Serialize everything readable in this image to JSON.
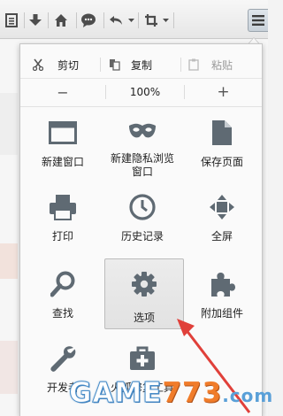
{
  "toolbar": {
    "buttons": [
      {
        "name": "bookmark-list-icon"
      },
      {
        "name": "download-icon"
      },
      {
        "name": "home-icon"
      },
      {
        "name": "chat-icon"
      },
      {
        "name": "undo-icon"
      },
      {
        "name": "crop-icon"
      },
      {
        "name": "hamburger-menu-icon"
      }
    ]
  },
  "menu": {
    "edit": {
      "cut_label": "剪切",
      "copy_label": "复制",
      "paste_label": "粘贴"
    },
    "zoom": {
      "minus_label": "−",
      "value": "100%",
      "plus_label": "+"
    },
    "items": [
      {
        "label": "新建窗口",
        "icon": "window-icon"
      },
      {
        "label": "新建隐私浏览\n窗口",
        "icon": "mask-icon"
      },
      {
        "label": "保存页面",
        "icon": "page-icon"
      },
      {
        "label": "打印",
        "icon": "printer-icon"
      },
      {
        "label": "历史记录",
        "icon": "clock-icon"
      },
      {
        "label": "全屏",
        "icon": "fullscreen-icon"
      },
      {
        "label": "查找",
        "icon": "magnifier-icon"
      },
      {
        "label": "选项",
        "icon": "gear-icon",
        "selected": true
      },
      {
        "label": "附加组件",
        "icon": "puzzle-icon"
      },
      {
        "label": "开发者",
        "icon": "wrench-icon"
      },
      {
        "label": "火狐修复工具",
        "icon": "medkit-icon"
      }
    ]
  },
  "watermark": {
    "part1": "GAME",
    "part2": "773",
    "part3": ".com"
  },
  "colors": {
    "icon": "#5f6a73",
    "arrow": "#e0403a",
    "watermark_orange": "#f07c2a",
    "watermark_blue": "#4a8ec9"
  }
}
